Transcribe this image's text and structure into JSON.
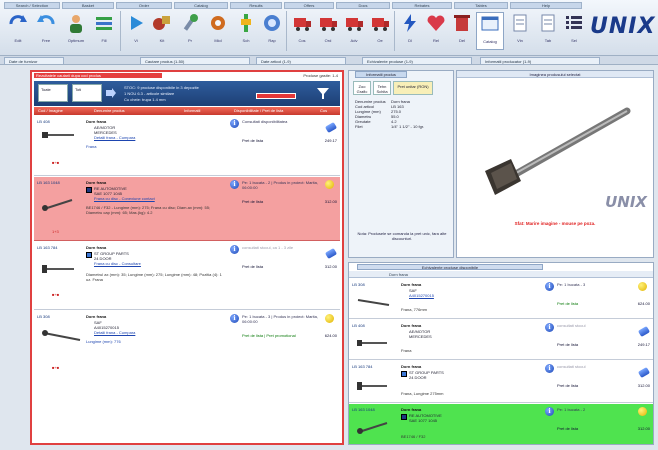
{
  "toolbar": {
    "groups": [
      "Search / Selection",
      "Basket",
      "Order",
      "Catalog",
      "Results",
      "Offers",
      "Docs",
      "Rebates",
      "Tables",
      "Help"
    ],
    "tools": [
      "Edit",
      "Free",
      "Optimum",
      "Fill",
      "Vi",
      "Kit",
      "Pr",
      "Miol",
      "Sch",
      "Rap",
      "Cos",
      "Ord",
      "Adv",
      "Oe",
      "Dl",
      "Rel",
      "Del",
      "Catalog",
      "Vin",
      "Tab",
      "Sel"
    ],
    "brand": "UNIX"
  },
  "tabs": [
    "Date de furnizor",
    "Cautare produs (1-50)",
    "Date articol (1-9)",
    "Echivalente produse (1-9)",
    "Informatii producator (1-9)"
  ],
  "left_panel": {
    "title_tag": "Rezultatele cautarii dupa cod produs",
    "found": "Produse gasite: 1-4",
    "filter": {
      "sel1": "Toate",
      "sel2": "Toti",
      "lines": [
        "STOC: 9 produse disponibile in 3 depozite",
        "1 NOU 6.3 - articole similare",
        "Cu cheie: trupa 1.4 mm"
      ]
    },
    "columns": [
      "Cod / Imagine",
      "Denumire produs",
      "Informatii",
      "Disponibilitate / Pret de lista",
      "Cos"
    ],
    "rows": [
      {
        "code": "LB 408",
        "title": "Dorn frana",
        "sub1": "AE/MOTOR",
        "sub2": "MERCEDES",
        "link": "Detalii frana - Cumpara",
        "desc": "Frana",
        "marker": "■+■",
        "avail": "Consultati disponibilitatea",
        "price": "Pret de lista",
        "amt": "249.17"
      },
      {
        "code": "LB 163 1048",
        "title": "Dorn frana",
        "sub1": "RE AUTOMOTIVE",
        "sub2": "SAE 1077 1045",
        "link": "Frana cu disc - Conexiune contact",
        "desc": "BE1746 / F32 - Lungime (mm): 275; Frana cu disc; Diam.ax (mm): 55; Diametru cap (mm): 65; Mas.(kg): 4.2",
        "marker": "1+3",
        "avail": "Pe: 1 bucata - 2 | Produs in proiect: Marita, 06:00:00",
        "price": "Pret de lista",
        "amt": "312.00"
      },
      {
        "code": "LB 163 784",
        "title": "Dorn frana",
        "sub1": "ST GROUP PARTS",
        "sub2": "24 DOOR",
        "link": "Frana cu disc - Consultare",
        "desc": "Diametrul ax (mm): 35; Lungime (mm): 275; Lungime (mm): 48; Pozitia (4): 1 uz. Frana",
        "marker": "■+■",
        "avail": "consultati stocul, ca 1 - 3 zile",
        "price": "Pret de lista",
        "amt": "312.00"
      },
      {
        "code": "LB 308",
        "title": "Dorn frana",
        "sub1": "SAF",
        "sub2": "A4015270015",
        "link": "Detalii frana - Cumpara",
        "desc": "Lungime (mm): 776",
        "marker": "■+■",
        "avail": "Pe: 1 bucata - 3 | Produs in proiect: Marita, 06:00:00",
        "price": "Pret de lista | Pret promotional",
        "amt": "624.00"
      }
    ]
  },
  "center_panel": {
    "title": "Informatii produs",
    "buttons": [
      "Zoo Grafic",
      "Tehn Schita",
      "Pret unitar (RON)"
    ],
    "specs": [
      [
        "Denumire produs",
        "Dorn frana"
      ],
      [
        "Cod articol",
        "LB 163"
      ],
      [
        "Lungime (mm)",
        "275.0"
      ],
      [
        "Diametru",
        "55.0"
      ],
      [
        "Greutate",
        "4.2"
      ],
      [
        "Filet",
        "1/4\" 1 1/2\" - 10 fgr."
      ]
    ],
    "note": "Nota: Produsele se comanda la pret unic, fara alte discounturi."
  },
  "image_panel": {
    "title": "Imaginea produsului selectat",
    "caption": "Sfat: Marire imagine - mouse pe poza.",
    "watermark": "UNIX"
  },
  "eq_panel": {
    "title": "Echivalente produse disponibile",
    "header": "Dorn frana",
    "rows": [
      {
        "code": "LB 308",
        "title": "Dorn frana",
        "sub1": "SAF",
        "sub2": "A4015270015",
        "desc": "Frana, 776mm",
        "avail": "Pe: 1 bucata - 3",
        "price": "Pret de lista",
        "amt": "624.00"
      },
      {
        "code": "LB 408",
        "title": "Dorn frana",
        "sub1": "AE/MOTOR",
        "sub2": "MERCEDES",
        "desc": "Frana",
        "avail": "consultati stocul",
        "price": "Pret de lista",
        "amt": "249.17"
      },
      {
        "code": "LB 163 784",
        "title": "Dorn frana",
        "sub1": "ST GROUP PARTS",
        "sub2": "24 DOOR",
        "desc": "Frana, Lungime 275mm",
        "avail": "consultati stocul",
        "price": "Pret de lista",
        "amt": "312.00"
      },
      {
        "code": "LB 163 1048",
        "title": "Dorn frana",
        "sub1": "RE AUTOMOTIVE",
        "sub2": "SAE 1077 1045",
        "desc": "BE1746 / F32",
        "avail": "Pe: 1 bucata - 2",
        "price": "Pret de lista",
        "amt": "312.00"
      }
    ]
  }
}
